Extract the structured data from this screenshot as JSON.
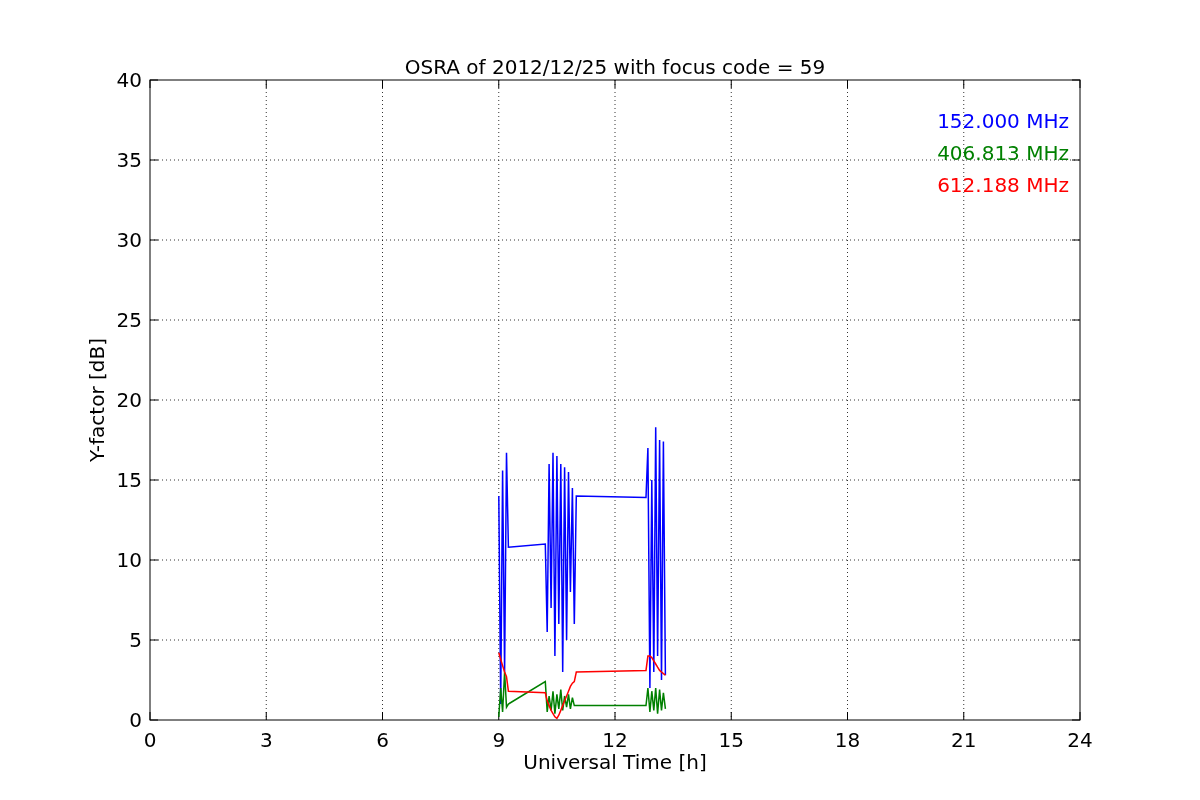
{
  "chart_data": {
    "type": "line",
    "title": "OSRA of 2012/12/25 with focus code = 59",
    "xlabel": "Universal Time [h]",
    "ylabel": "Y-factor [dB]",
    "x": [
      9.0,
      9.05,
      9.1,
      9.15,
      9.2,
      9.25,
      10.2,
      10.25,
      10.3,
      10.35,
      10.4,
      10.45,
      10.5,
      10.55,
      10.6,
      10.65,
      10.7,
      10.75,
      10.8,
      10.85,
      10.9,
      10.95,
      11.0,
      12.8,
      12.85,
      12.9,
      12.95,
      13.0,
      13.05,
      13.1,
      13.15,
      13.2,
      13.25,
      13.3
    ],
    "series": [
      {
        "name": "152.000 MHz",
        "color": "#0000ff",
        "values": [
          14,
          1,
          15.6,
          3,
          16.7,
          10.8,
          11,
          5.5,
          16,
          7,
          16.7,
          4,
          16.5,
          6,
          16,
          3,
          15.8,
          5,
          15.5,
          8,
          14.5,
          6,
          14,
          13.9,
          17,
          2,
          15,
          3,
          18.3,
          4,
          17.5,
          2.5,
          17.4,
          2.8
        ]
      },
      {
        "name": "406.813 MHz",
        "color": "#008000",
        "values": [
          0.2,
          2,
          0.5,
          3,
          0.8,
          1.0,
          2.4,
          0.5,
          1.5,
          0.6,
          1.8,
          0.4,
          1.6,
          0.7,
          1.9,
          0.6,
          1.5,
          0.8,
          1.6,
          0.7,
          1.4,
          0.9,
          0.9,
          0.9,
          2,
          0.5,
          1.8,
          0.6,
          2,
          0.4,
          1.9,
          0.6,
          1.7,
          0.7
        ]
      },
      {
        "name": "612.188 MHz",
        "color": "#ff0000",
        "values": [
          4.2,
          3.8,
          3.4,
          3.0,
          2.7,
          1.8,
          1.7,
          1.2,
          0.9,
          0.6,
          0.4,
          0.2,
          0.1,
          0.3,
          0.6,
          0.9,
          1.2,
          1.5,
          1.8,
          2.1,
          2.3,
          2.4,
          3.0,
          3.1,
          4.0,
          4.0,
          3.9,
          3.7,
          3.5,
          3.3,
          3.1,
          3.0,
          2.9,
          2.8
        ]
      }
    ],
    "xlim": [
      0,
      24
    ],
    "ylim": [
      0,
      40
    ],
    "xticks": [
      0,
      3,
      6,
      9,
      12,
      15,
      18,
      21,
      24
    ],
    "yticks": [
      0,
      5,
      10,
      15,
      20,
      25,
      30,
      35,
      40
    ],
    "grid": true
  }
}
